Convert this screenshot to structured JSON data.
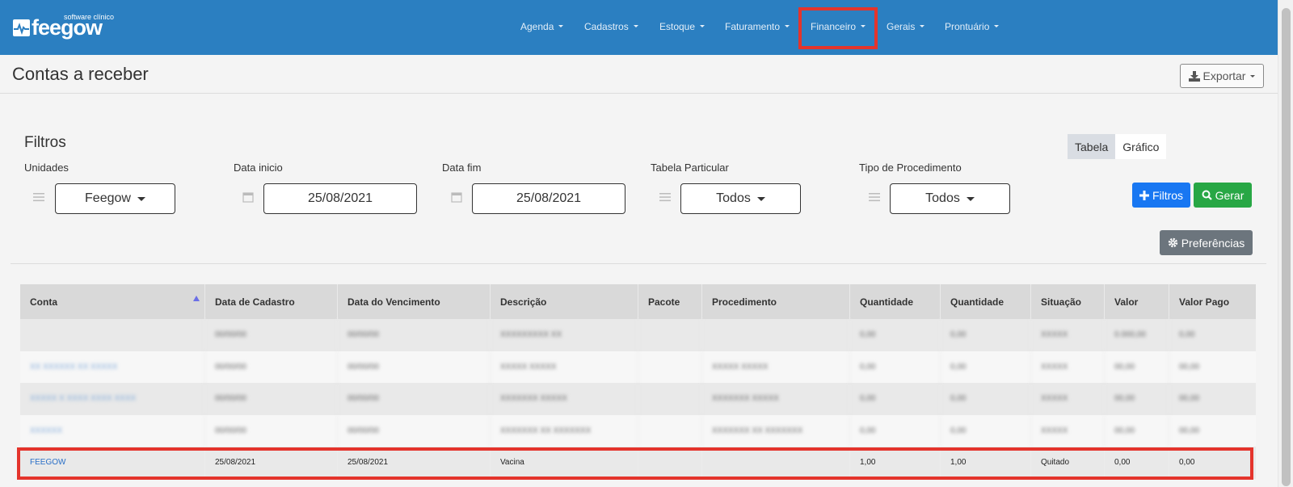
{
  "brand": {
    "name": "feegow",
    "tagline": "software clínico",
    "color": "#2b7fc1"
  },
  "nav": {
    "items": [
      "Agenda",
      "Cadastros",
      "Estoque",
      "Faturamento",
      "Financeiro",
      "Gerais",
      "Prontuário"
    ],
    "highlighted": "Financeiro"
  },
  "header": {
    "title": "Contas a receber",
    "export_label": "Exportar"
  },
  "filters": {
    "title": "Filtros",
    "unidades": {
      "label": "Unidades",
      "value": "Feegow"
    },
    "data_inicio": {
      "label": "Data inicio",
      "value": "25/08/2021"
    },
    "data_fim": {
      "label": "Data fim",
      "value": "25/08/2021"
    },
    "tabela_particular": {
      "label": "Tabela Particular",
      "value": "Todos"
    },
    "tipo_procedimento": {
      "label": "Tipo de Procedimento",
      "value": "Todos"
    }
  },
  "view_toggle": {
    "options": [
      "Tabela",
      "Gráfico"
    ],
    "selected": "Tabela"
  },
  "buttons": {
    "filtros": "Filtros",
    "gerar": "Gerar",
    "preferencias": "Preferências"
  },
  "table": {
    "columns": [
      "Conta",
      "Data de Cadastro",
      "Data do Vencimento",
      "Descrição",
      "Pacote",
      "Procedimento",
      "Quantidade",
      "Quantidade",
      "Situação",
      "Valor",
      "Valor Pago"
    ],
    "sorted_column": "Conta",
    "rows": [
      {
        "blurred": true,
        "cells": [
          "",
          "00/00/00",
          "00/00/00",
          "XXXXXXXXX XX",
          "",
          "",
          "0,00",
          "0,00",
          "XXXXX",
          "0.000,00",
          "0,00"
        ]
      },
      {
        "blurred": true,
        "cells": [
          "XX XXXXXX XX XXXXX",
          "00/00/00",
          "00/00/00",
          "XXXXX XXXXX",
          "",
          "XXXXX XXXXX",
          "0,00",
          "0,00",
          "XXXXX",
          "00,00",
          "00,00"
        ]
      },
      {
        "blurred": true,
        "cells": [
          "XXXXX X XXXX XXXX XXXX",
          "00/00/00",
          "00/00/00",
          "XXXXXXX XXXXX",
          "",
          "XXXXXXX XXXXX",
          "0,00",
          "0,00",
          "XXXXX",
          "00,00",
          "00,00"
        ]
      },
      {
        "blurred": true,
        "cells": [
          "XXXXXX",
          "00/00/00",
          "00/00/00",
          "XXXXXXX XX XXXXXXX",
          "",
          "XXXXXXX XX XXXXXXX",
          "0,00",
          "0,00",
          "XXXXX",
          "00,00",
          "00,00"
        ]
      },
      {
        "blurred": false,
        "cells": [
          "FEEGOW",
          "25/08/2021",
          "25/08/2021",
          "Vacina",
          "",
          "",
          "1,00",
          "1,00",
          "Quitado",
          "0,00",
          "0,00"
        ]
      }
    ]
  }
}
